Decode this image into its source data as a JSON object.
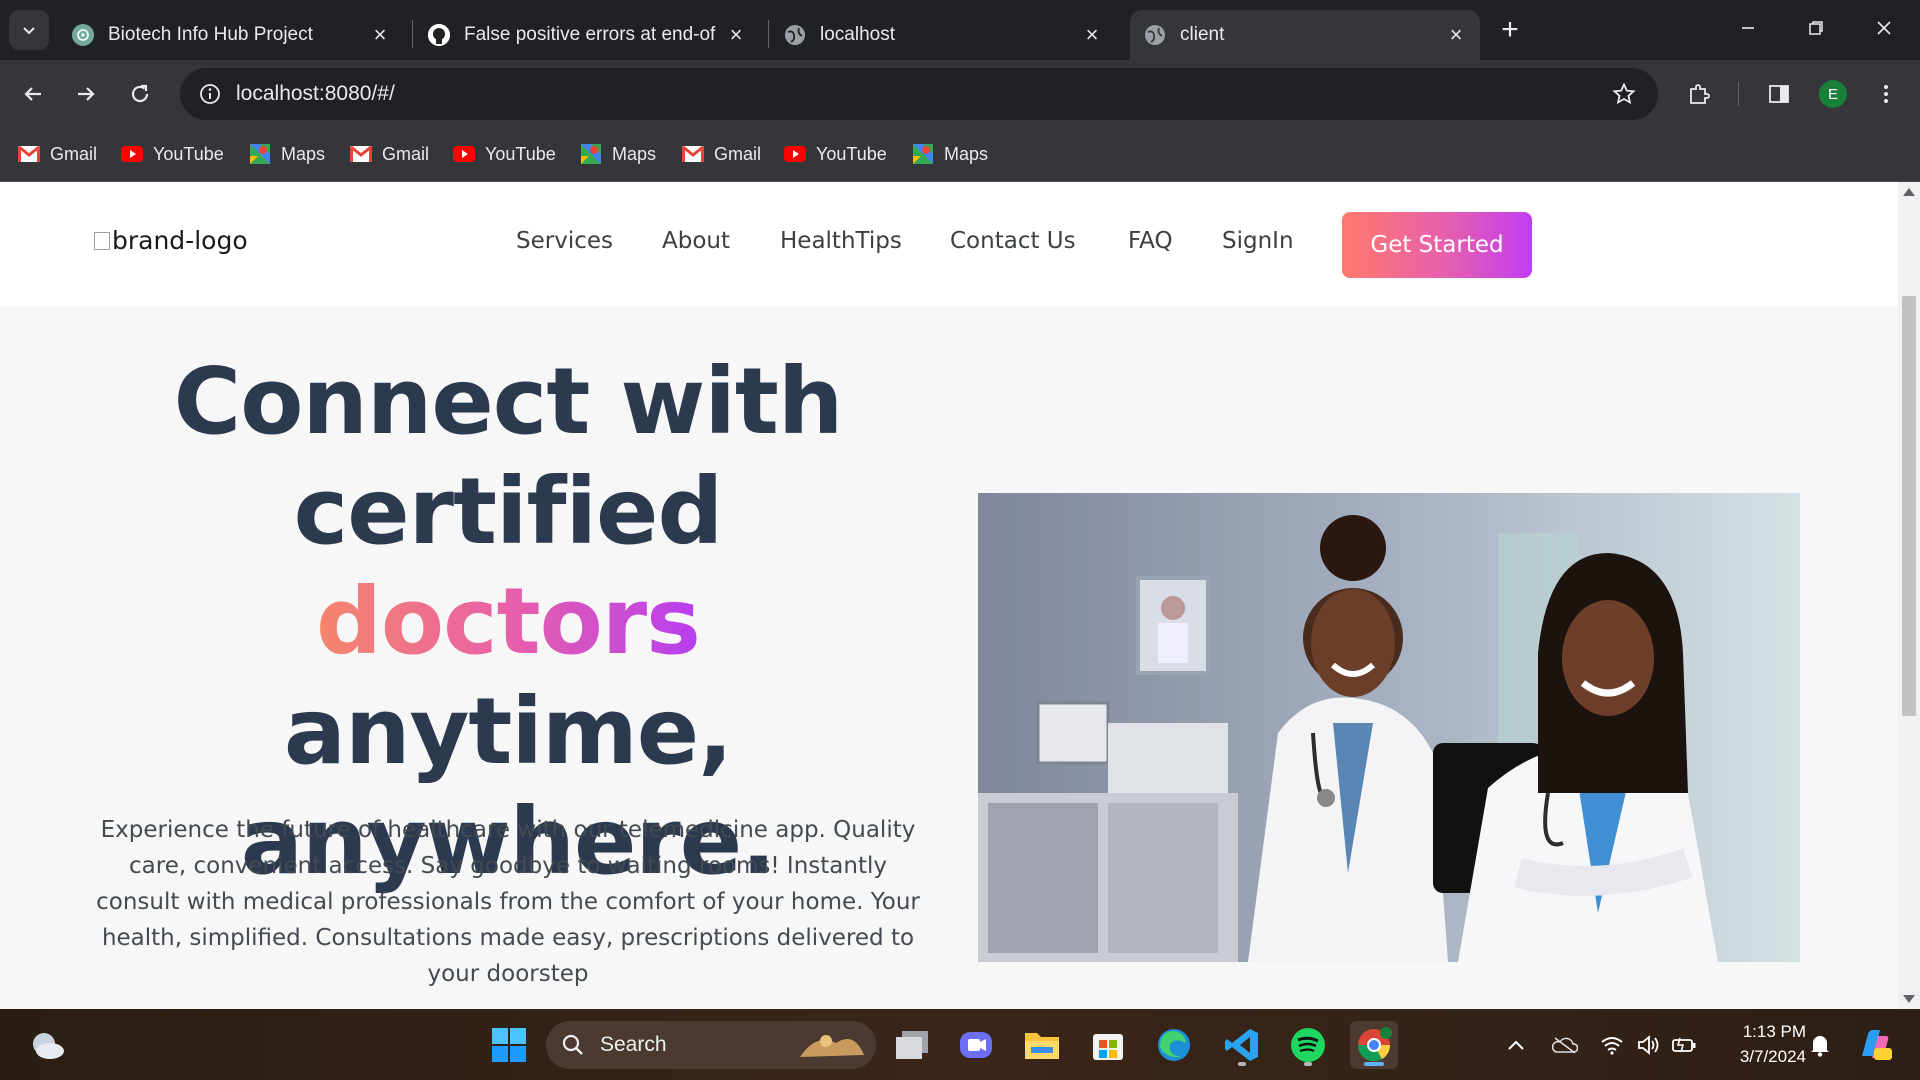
{
  "browser": {
    "tabs": [
      {
        "title": "Biotech Info Hub Project",
        "icon": "chatgpt-icon",
        "active": false
      },
      {
        "title": "False positive errors at end-of-f",
        "icon": "github-icon",
        "active": false
      },
      {
        "title": "localhost",
        "icon": "globe-icon",
        "active": false
      },
      {
        "title": "client",
        "icon": "globe-icon",
        "active": true
      }
    ],
    "url": "localhost:8080/#/",
    "profile_initial": "E",
    "bookmarks": [
      {
        "label": "Gmail",
        "icon": "gmail-icon"
      },
      {
        "label": "YouTube",
        "icon": "youtube-icon"
      },
      {
        "label": "Maps",
        "icon": "maps-icon"
      },
      {
        "label": "Gmail",
        "icon": "gmail-icon"
      },
      {
        "label": "YouTube",
        "icon": "youtube-icon"
      },
      {
        "label": "Maps",
        "icon": "maps-icon"
      },
      {
        "label": "Gmail",
        "icon": "gmail-icon"
      },
      {
        "label": "YouTube",
        "icon": "youtube-icon"
      },
      {
        "label": "Maps",
        "icon": "maps-icon"
      }
    ]
  },
  "site": {
    "brand_alt": "brand-logo",
    "nav": [
      "Services",
      "About",
      "HealthTips",
      "Contact Us",
      "FAQ",
      "SignIn"
    ],
    "cta": "Get Started",
    "hero": {
      "title_part1": "Connect with certified",
      "title_highlight": "doctors",
      "title_part2": "anytime, anywhere.",
      "description": "Experience the future of healthcare with our telemedicine app. Quality care, convenient access. Say goodbye to waiting rooms! Instantly consult with medical professionals from the comfort of your home. Your health, simplified. Consultations made easy, prescriptions delivered to your doorstep"
    },
    "colors": {
      "heading": "#2b3a4e",
      "gradient_start": "#ff7a6b",
      "gradient_end": "#c13df2"
    }
  },
  "taskbar": {
    "search_label": "Search",
    "time": "1:13 PM",
    "date": "3/7/2024"
  }
}
